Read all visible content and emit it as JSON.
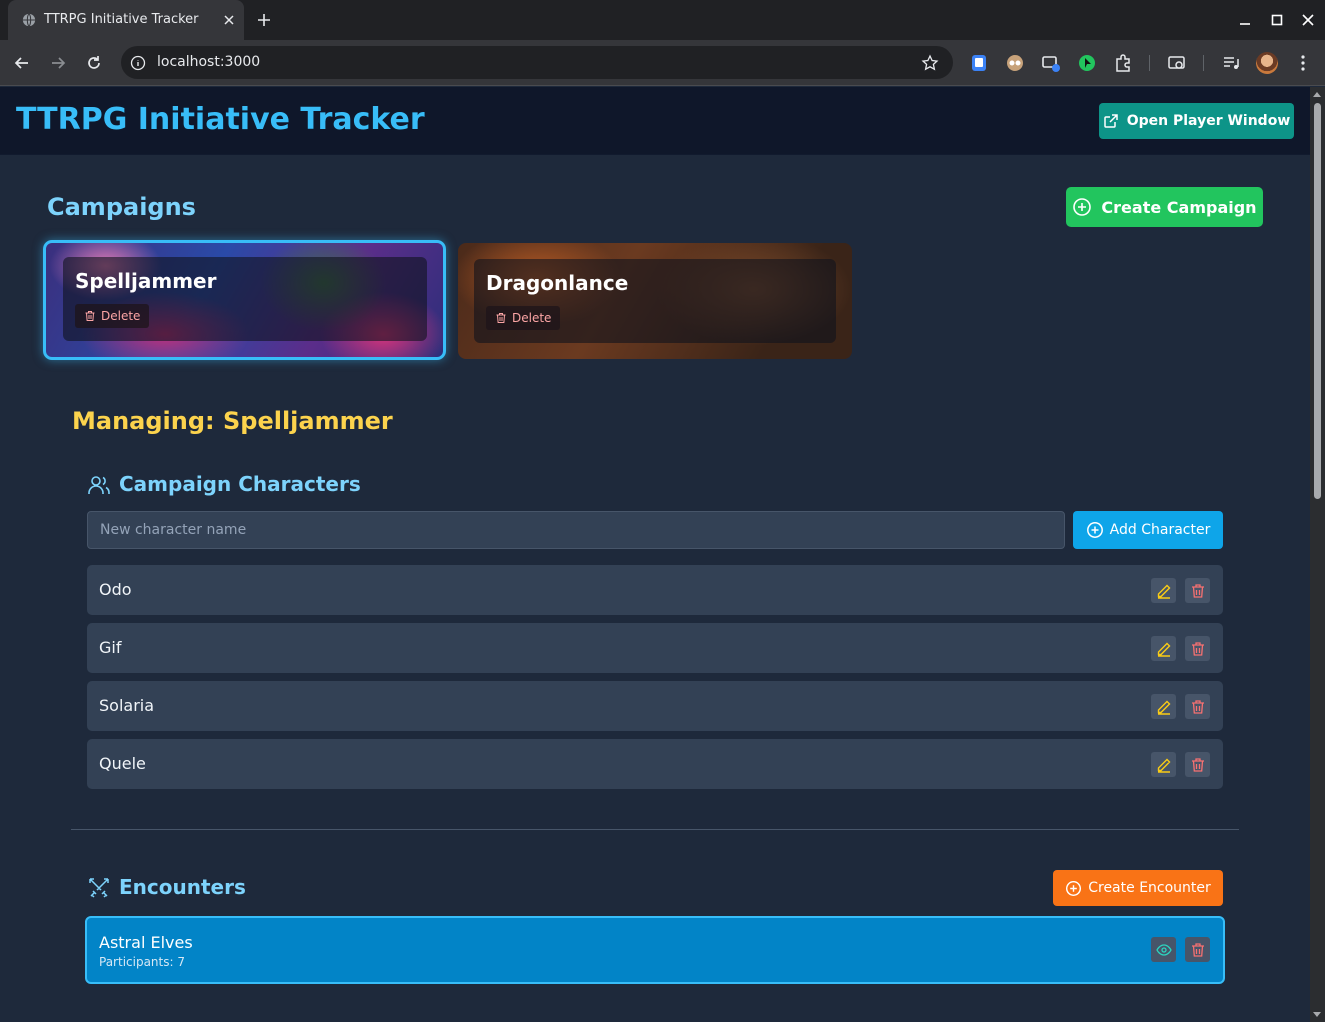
{
  "browser": {
    "tab_title": "TTRPG Initiative Tracker",
    "url": "localhost:3000"
  },
  "header": {
    "title": "TTRPG Initiative Tracker",
    "player_window_label": "Open Player Window"
  },
  "campaigns": {
    "title": "Campaigns",
    "create_label": "Create Campaign",
    "items": [
      {
        "name": "Spelljammer",
        "delete_label": "Delete",
        "selected": true
      },
      {
        "name": "Dragonlance",
        "delete_label": "Delete",
        "selected": false
      }
    ]
  },
  "managing": {
    "title": "Managing: Spelljammer"
  },
  "characters": {
    "title": "Campaign Characters",
    "input_placeholder": "New character name",
    "add_label": "Add Character",
    "items": [
      {
        "name": "Odo"
      },
      {
        "name": "Gif"
      },
      {
        "name": "Solaria"
      },
      {
        "name": "Quele"
      }
    ]
  },
  "encounters": {
    "title": "Encounters",
    "create_label": "Create Encounter",
    "items": [
      {
        "name": "Astral Elves",
        "participants": "Participants: 7",
        "selected": true
      }
    ]
  },
  "colors": {
    "accent": "#38bdf8",
    "managing": "#fcd34d",
    "create_campaign": "#22c55e",
    "add_character": "#0ea5e9",
    "create_encounter": "#f97316",
    "player_window": "#0d9488",
    "edit_icon": "#facc15",
    "delete_icon": "#f87171"
  }
}
